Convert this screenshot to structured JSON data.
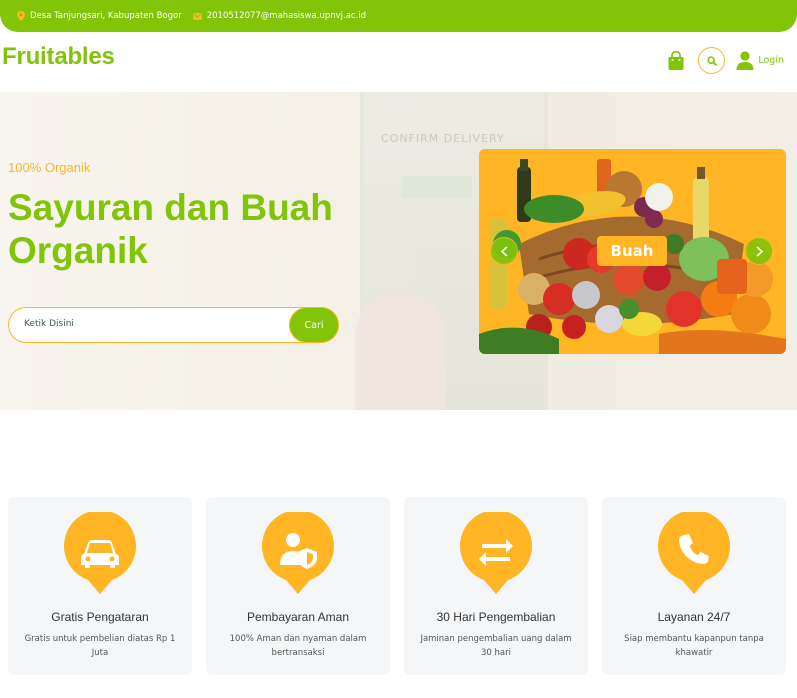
{
  "topbar": {
    "address": "Desa Tanjungsari, Kabupaten Bogor",
    "email": "2010512077@mahasiswa.upnvj.ac.id"
  },
  "navbar": {
    "brand": "Fruitables",
    "login_label": "Login"
  },
  "hero": {
    "background_text": "CONFIRM DELIVERY",
    "subtitle": "100% Organik",
    "headline": "Sayuran dan Buah Organik",
    "search_placeholder": "Ketik Disini",
    "search_button": "Cari",
    "carousel": {
      "slide_label": "Buah"
    }
  },
  "features": [
    {
      "icon": "car-icon",
      "title": "Gratis Pengataran",
      "desc": "Gratis untuk pembelian diatas Rp 1 Juta"
    },
    {
      "icon": "user-shield-icon",
      "title": "Pembayaran Aman",
      "desc": "100% Aman dan nyaman dalam bertransaksi"
    },
    {
      "icon": "exchange-icon",
      "title": "30 Hari Pengembalian",
      "desc": "Jaminan pengembalian uang dalam 30 hari"
    },
    {
      "icon": "phone-icon",
      "title": "Layanan 24/7",
      "desc": "Siap membantu kapanpun tanpa khawatir"
    }
  ],
  "colors": {
    "primary": "#81c408",
    "secondary": "#ffb524",
    "card_bg": "#f4f6f8"
  }
}
